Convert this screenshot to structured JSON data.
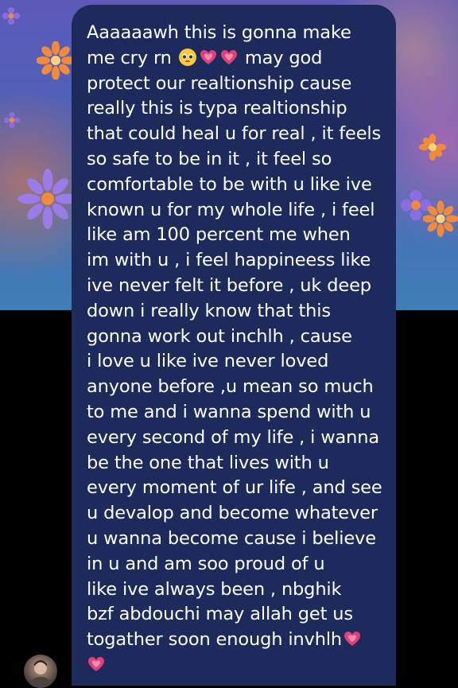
{
  "message": {
    "line1": "Aaaaaawh this is gonna make",
    "line2_a": "me cry rn",
    "line2_b": "may god",
    "line3": "protect our realtionship cause",
    "line4": "really this is typa realtionship",
    "line5": "that could heal u for real , it feels",
    "line6": "so safe to be in it , it feel so",
    "line7": "comfortable to be with u like ive",
    "line8": "known u for my whole life , i feel",
    "line9": "like am 100 percent me when",
    "line10": "im with u , i feel happineess like",
    "line11": "ive never felt it before , uk deep",
    "line12": "down i really know that this",
    "line13": "gonna work out inchlh , cause",
    "line14": "i love u like ive never loved",
    "line15": "anyone before ,u mean so much",
    "line16": "to me and i wanna spend with u",
    "line17": "every second of my life , i wanna",
    "line18": "be the one that lives with u",
    "line19": "every moment of ur life , and see",
    "line20": "u devalop and become whatever",
    "line21": "u wanna become cause i believe",
    "line22": "in u and am soo proud of u",
    "line23": "like ive always been , nbghik",
    "line24": "bzf abdouchi may allah get us",
    "line25": "togather soon enough invhlh"
  },
  "icons": {
    "pleading": "pleading-face-emoji",
    "heart": "growing-heart-emoji",
    "avatar": "contact-avatar"
  },
  "colors": {
    "bubble": "#1c2a5c",
    "text": "#ffffff",
    "wallpaper_top": "#5d5ab8",
    "wallpaper_bottom": "#3f7fb6",
    "flower_orange": "#f08a3c",
    "flower_purple": "#8a6ee0",
    "heart_pink": "#e0407a"
  }
}
